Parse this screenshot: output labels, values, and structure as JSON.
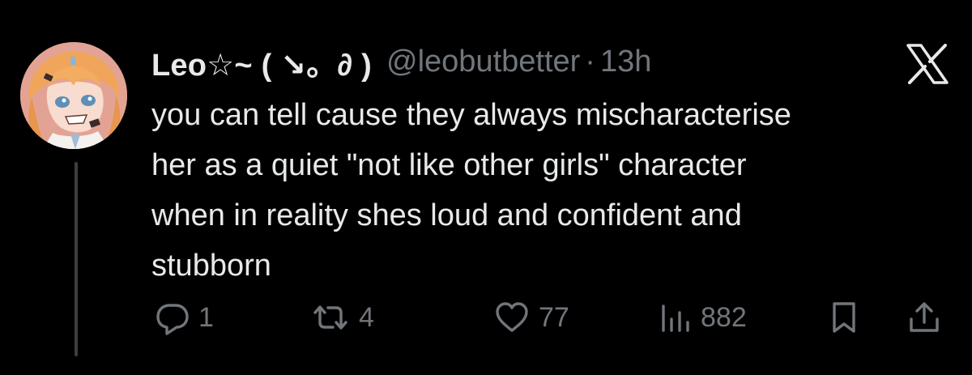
{
  "tweet": {
    "display_name": "Leo☆~ ( ↘。∂ )",
    "handle": "@leobutbetter",
    "separator": "·",
    "time": "13h",
    "text": "you can tell cause they always mischaracterise\nher as a quiet \"not like other girls\" character\nwhen in reality shes loud and confident and\nstubborn"
  },
  "actions": {
    "reply_count": "1",
    "repost_count": "4",
    "like_count": "77",
    "view_count": "882"
  },
  "icons": {
    "platform": "x-logo-icon",
    "reply": "reply-icon",
    "repost": "repost-icon",
    "like": "heart-icon",
    "views": "views-icon",
    "bookmark": "bookmark-icon",
    "share": "share-icon"
  },
  "colors": {
    "background": "#000000",
    "text": "#e7e9ea",
    "muted": "#71767b",
    "thread_line": "#3a3f44"
  }
}
